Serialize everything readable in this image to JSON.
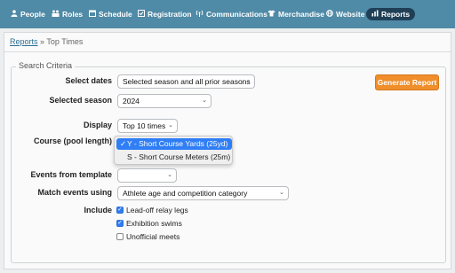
{
  "nav": {
    "items": [
      {
        "label": "People",
        "icon": "person-icon"
      },
      {
        "label": "Roles",
        "icon": "roles-icon"
      },
      {
        "label": "Schedule",
        "icon": "calendar-icon"
      },
      {
        "label": "Registration",
        "icon": "checklist-icon"
      },
      {
        "label": "Communications",
        "icon": "broadcast-icon"
      },
      {
        "label": "Merchandise",
        "icon": "shirt-icon"
      },
      {
        "label": "Website",
        "icon": "globe-icon"
      },
      {
        "label": "Reports",
        "icon": "bar-chart-icon"
      }
    ],
    "active": "Reports"
  },
  "breadcrumb": {
    "link": "Reports",
    "separator": "»",
    "current": "Top Times"
  },
  "form": {
    "legend": "Search Criteria",
    "select_dates": {
      "label": "Select dates",
      "value": "Selected season and all prior seasons"
    },
    "selected_season": {
      "label": "Selected season",
      "value": "2024"
    },
    "display": {
      "label": "Display",
      "value": "Top 10 times"
    },
    "course": {
      "label": "Course (pool length)",
      "options": [
        "Y - Short Course Yards (25yd)",
        "S - Short Course Meters (25m)"
      ],
      "selected_index": 0
    },
    "events_from_template": {
      "label": "Events from template",
      "value": ""
    },
    "match_events": {
      "label": "Match events using",
      "value": "Athlete age and competition category"
    },
    "include": {
      "label": "Include",
      "options": [
        {
          "label": "Lead-off relay legs",
          "checked": true
        },
        {
          "label": "Exhibition swims",
          "checked": true
        },
        {
          "label": "Unofficial meets",
          "checked": false
        }
      ]
    },
    "generate_button": "Generate Report"
  },
  "colors": {
    "nav_bg": "#4f8aa6",
    "nav_active": "#1f3f57",
    "accent": "#ef8e2a",
    "select_highlight": "#2f7ef5"
  }
}
